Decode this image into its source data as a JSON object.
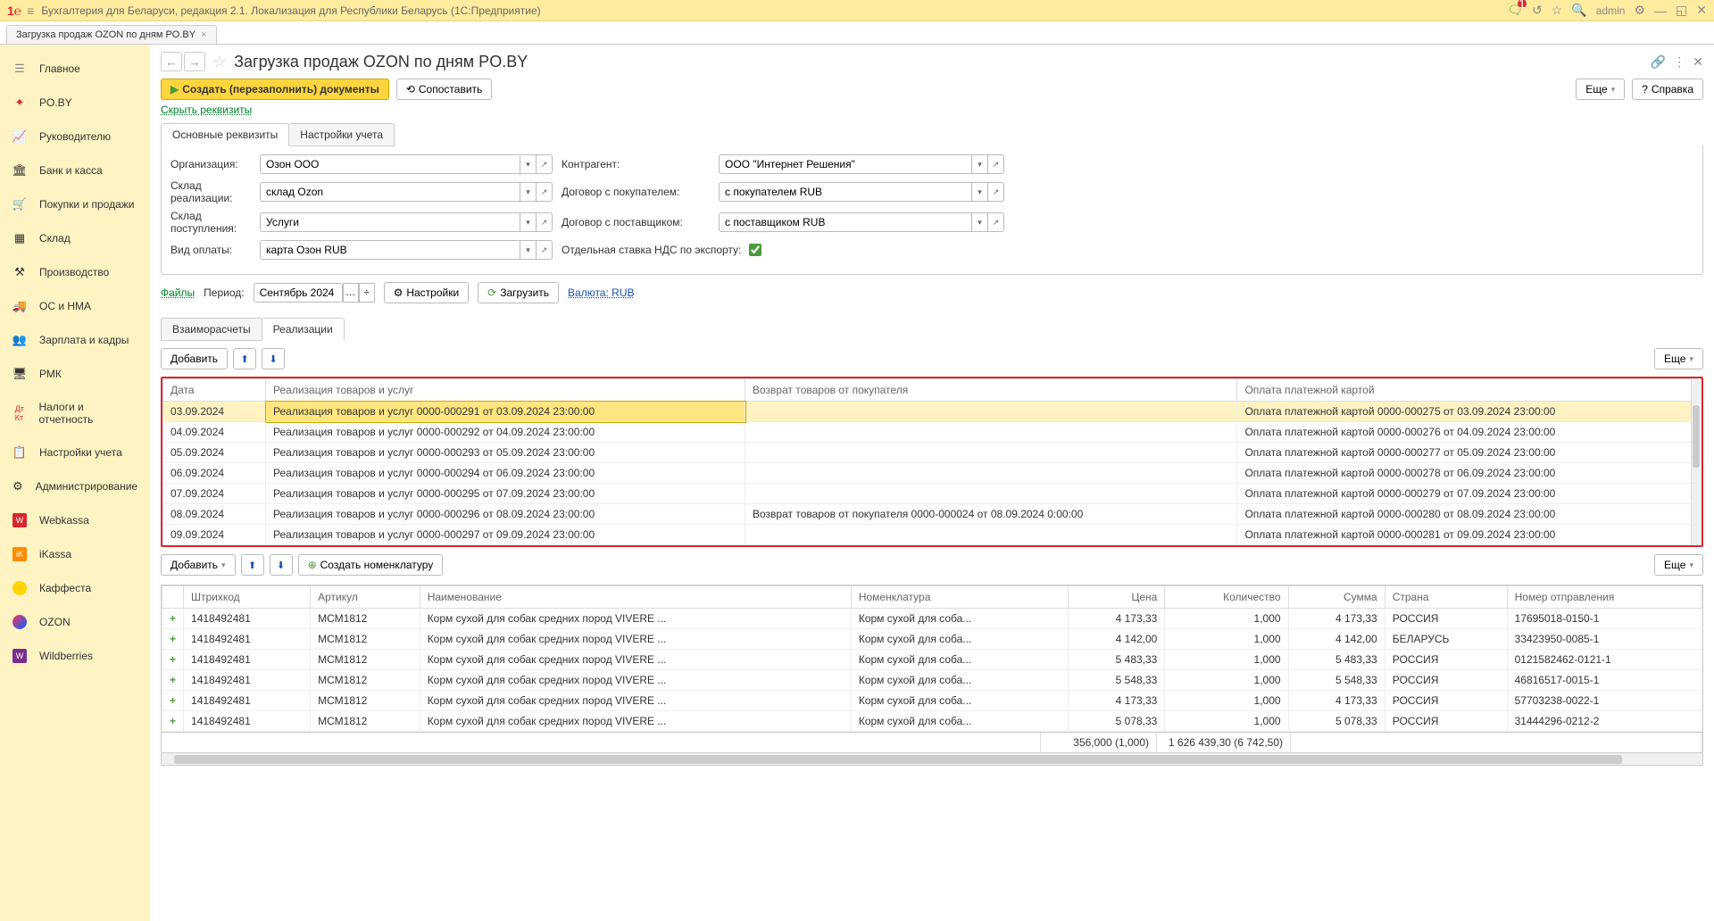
{
  "top": {
    "title": "Бухгалтерия для Беларуси, редакция 2.1. Локализация для Республики Беларусь   (1С:Предприятие)",
    "user": "admin",
    "notif_count": "1"
  },
  "tab": {
    "label": "Загрузка продаж OZON по дням PO.BY"
  },
  "sidebar": {
    "items": [
      {
        "label": "Главное"
      },
      {
        "label": "PO.BY"
      },
      {
        "label": "Руководителю"
      },
      {
        "label": "Банк и касса"
      },
      {
        "label": "Покупки и продажи"
      },
      {
        "label": "Склад"
      },
      {
        "label": "Производство"
      },
      {
        "label": "ОС и НМА"
      },
      {
        "label": "Зарплата и кадры"
      },
      {
        "label": "РМК"
      },
      {
        "label": "Налоги и отчетность"
      },
      {
        "label": "Настройки учета"
      },
      {
        "label": "Администрирование"
      },
      {
        "label": "Webkassa"
      },
      {
        "label": "iKassa"
      },
      {
        "label": "Каффеста"
      },
      {
        "label": "OZON"
      },
      {
        "label": "Wildberries"
      }
    ]
  },
  "page": {
    "title": "Загрузка продаж OZON по дням PO.BY",
    "create_btn": "Создать (перезаполнить) документы",
    "compare_btn": "Сопоставить",
    "more_btn": "Еще",
    "help_btn": "Справка",
    "hide_link": "Скрыть реквизиты"
  },
  "formTabs": {
    "main": "Основные реквизиты",
    "settings": "Настройки учета"
  },
  "form": {
    "org_label": "Организация:",
    "org_value": "Озон ООО",
    "wh_real_label": "Склад реализации:",
    "wh_real_value": "склад Ozon",
    "wh_in_label": "Склад поступления:",
    "wh_in_value": "Услуги",
    "pay_label": "Вид оплаты:",
    "pay_value": "карта Озон RUB",
    "contr_label": "Контрагент:",
    "contr_value": "ООО \"Интернет Решения\"",
    "buyer_label": "Договор с покупателем:",
    "buyer_value": "с покупателем RUB",
    "supplier_label": "Договор с поставщиком:",
    "supplier_value": "с поставщиком RUB",
    "vat_label": "Отдельная ставка НДС по экспорту:"
  },
  "period": {
    "files": "Файлы",
    "label": "Период:",
    "value": "Сентябрь 2024 г.",
    "settings_btn": "Настройки",
    "load_btn": "Загрузить",
    "currency": "Валюта: RUB"
  },
  "subTabs": {
    "calc": "Взаиморасчеты",
    "real": "Реализации"
  },
  "toolbar": {
    "add": "Добавить",
    "more": "Еще"
  },
  "grid1": {
    "cols": [
      "Дата",
      "Реализация товаров и услуг",
      "Возврат товаров от покупателя",
      "Оплата платежной картой"
    ],
    "rows": [
      {
        "date": "03.09.2024",
        "real": "Реализация товаров и услуг 0000-000291 от 03.09.2024 23:00:00",
        "ret": "",
        "pay": "Оплата платежной картой 0000-000275 от 03.09.2024 23:00:00"
      },
      {
        "date": "04.09.2024",
        "real": "Реализация товаров и услуг 0000-000292 от 04.09.2024 23:00:00",
        "ret": "",
        "pay": "Оплата платежной картой 0000-000276 от 04.09.2024 23:00:00"
      },
      {
        "date": "05.09.2024",
        "real": "Реализация товаров и услуг 0000-000293 от 05.09.2024 23:00:00",
        "ret": "",
        "pay": "Оплата платежной картой 0000-000277 от 05.09.2024 23:00:00"
      },
      {
        "date": "06.09.2024",
        "real": "Реализация товаров и услуг 0000-000294 от 06.09.2024 23:00:00",
        "ret": "",
        "pay": "Оплата платежной картой 0000-000278 от 06.09.2024 23:00:00"
      },
      {
        "date": "07.09.2024",
        "real": "Реализация товаров и услуг 0000-000295 от 07.09.2024 23:00:00",
        "ret": "",
        "pay": "Оплата платежной картой 0000-000279 от 07.09.2024 23:00:00"
      },
      {
        "date": "08.09.2024",
        "real": "Реализация товаров и услуг 0000-000296 от 08.09.2024 23:00:00",
        "ret": "Возврат товаров от покупателя 0000-000024 от 08.09.2024 0:00:00",
        "pay": "Оплата платежной картой 0000-000280 от 08.09.2024 23:00:00"
      },
      {
        "date": "09.09.2024",
        "real": "Реализация товаров и услуг 0000-000297 от 09.09.2024 23:00:00",
        "ret": "",
        "pay": "Оплата платежной картой 0000-000281 от 09.09.2024 23:00:00"
      }
    ]
  },
  "toolbar2": {
    "add": "Добавить",
    "create_nom": "Создать номенклатуру",
    "more": "Еще"
  },
  "grid2": {
    "cols": [
      "",
      "Штрихкод",
      "Артикул",
      "Наименование",
      "Номенклатура",
      "Цена",
      "Количество",
      "Сумма",
      "Страна",
      "Номер отправления"
    ],
    "rows": [
      {
        "bc": "1418492481",
        "art": "МСМ1812",
        "name": "Корм сухой для собак средних пород VIVERE ...",
        "nom": "Корм сухой для соба...",
        "price": "4 173,33",
        "qty": "1,000",
        "sum": "4 173,33",
        "country": "РОССИЯ",
        "ship": "17695018-0150-1"
      },
      {
        "bc": "1418492481",
        "art": "МСМ1812",
        "name": "Корм сухой для собак средних пород VIVERE ...",
        "nom": "Корм сухой для соба...",
        "price": "4 142,00",
        "qty": "1,000",
        "sum": "4 142,00",
        "country": "БЕЛАРУСЬ",
        "ship": "33423950-0085-1"
      },
      {
        "bc": "1418492481",
        "art": "МСМ1812",
        "name": "Корм сухой для собак средних пород VIVERE ...",
        "nom": "Корм сухой для соба...",
        "price": "5 483,33",
        "qty": "1,000",
        "sum": "5 483,33",
        "country": "РОССИЯ",
        "ship": "0121582462-0121-1"
      },
      {
        "bc": "1418492481",
        "art": "МСМ1812",
        "name": "Корм сухой для собак средних пород VIVERE ...",
        "nom": "Корм сухой для соба...",
        "price": "5 548,33",
        "qty": "1,000",
        "sum": "5 548,33",
        "country": "РОССИЯ",
        "ship": "46816517-0015-1"
      },
      {
        "bc": "1418492481",
        "art": "МСМ1812",
        "name": "Корм сухой для собак средних пород VIVERE ...",
        "nom": "Корм сухой для соба...",
        "price": "4 173,33",
        "qty": "1,000",
        "sum": "4 173,33",
        "country": "РОССИЯ",
        "ship": "57703238-0022-1"
      },
      {
        "bc": "1418492481",
        "art": "МСМ1812",
        "name": "Корм сухой для собак средних пород VIVERE ...",
        "nom": "Корм сухой для соба...",
        "price": "5 078,33",
        "qty": "1,000",
        "sum": "5 078,33",
        "country": "РОССИЯ",
        "ship": "31444296-0212-2"
      }
    ],
    "footer": {
      "qty": "356,000 (1,000)",
      "sum": "1 626 439,30 (6 742,50)"
    }
  }
}
